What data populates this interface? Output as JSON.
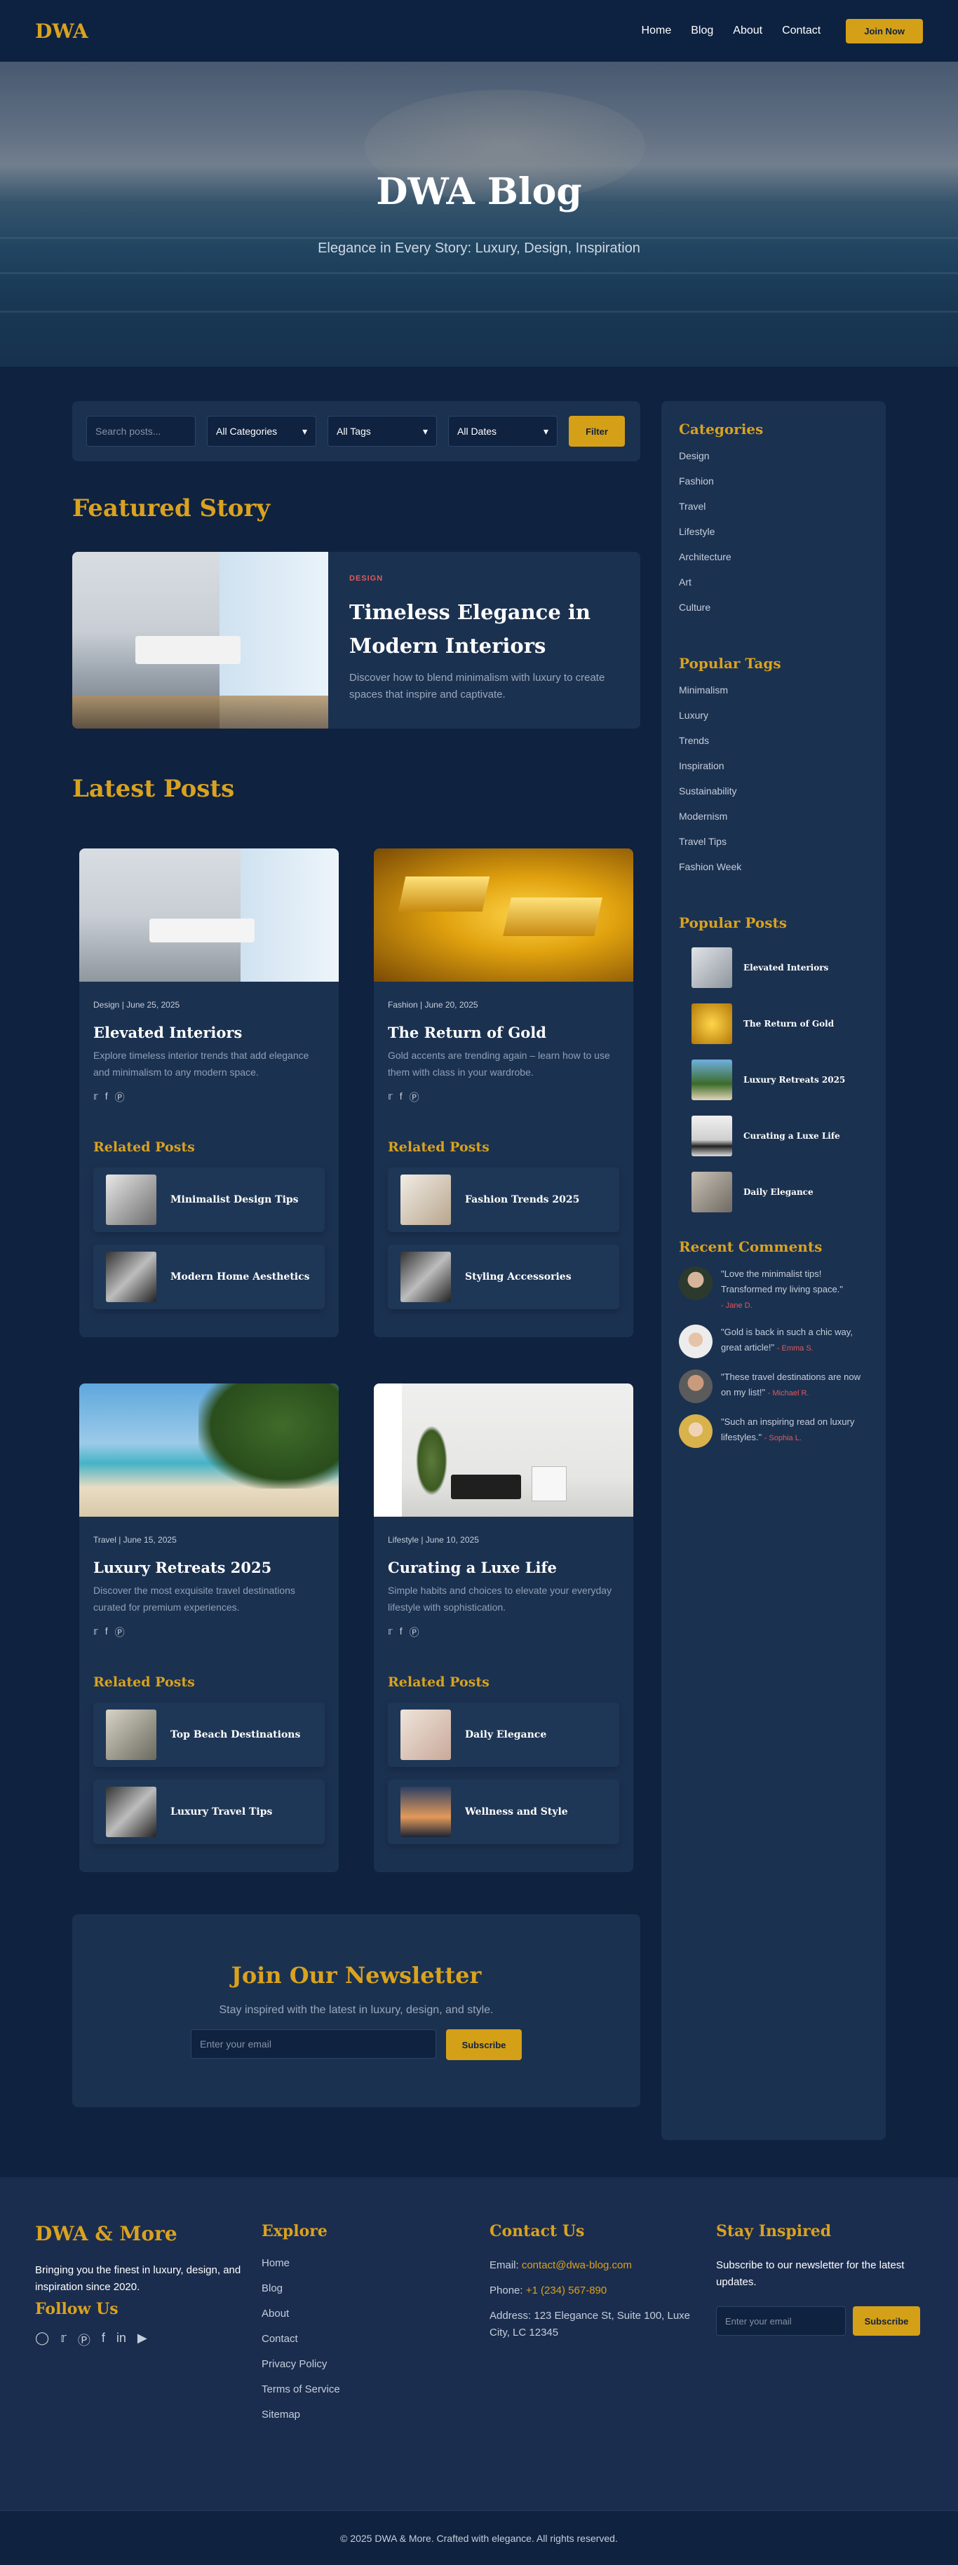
{
  "header": {
    "logo": "DWA",
    "nav": [
      "Home",
      "Blog",
      "About",
      "Contact"
    ],
    "cta": "Join Now"
  },
  "hero": {
    "title": "DWA Blog",
    "subtitle": "Elegance in Every Story: Luxury, Design, Inspiration"
  },
  "filters": {
    "search_placeholder": "Search posts...",
    "category": "All Categories",
    "tag": "All Tags",
    "date": "All Dates",
    "button": "Filter"
  },
  "featured": {
    "heading": "Featured Story",
    "tag": "DESIGN",
    "title": "Timeless Elegance in Modern Interiors",
    "excerpt": "Discover how to blend minimalism with luxury to create spaces that inspire and captivate."
  },
  "latest": {
    "heading": "Latest Posts",
    "related_heading": "Related Posts",
    "posts": [
      {
        "meta": "Design | June 25, 2025",
        "title": "Elevated Interiors",
        "excerpt": "Explore timeless interior trends that add elegance and minimalism to any modern space.",
        "related": [
          "Minimalist Design Tips",
          "Modern Home Aesthetics"
        ]
      },
      {
        "meta": "Fashion | June 20, 2025",
        "title": "The Return of Gold",
        "excerpt": "Gold accents are trending again – learn how to use them with class in your wardrobe.",
        "related": [
          "Fashion Trends 2025",
          "Styling Accessories"
        ]
      },
      {
        "meta": "Travel | June 15, 2025",
        "title": "Luxury Retreats 2025",
        "excerpt": "Discover the most exquisite travel destinations curated for premium experiences.",
        "related": [
          "Top Beach Destinations",
          "Luxury Travel Tips"
        ]
      },
      {
        "meta": "Lifestyle | June 10, 2025",
        "title": "Curating a Luxe Life",
        "excerpt": "Simple habits and choices to elevate your everyday lifestyle with sophistication.",
        "related": [
          "Daily Elegance",
          "Wellness and Style"
        ]
      }
    ]
  },
  "newsletter": {
    "title": "Join Our Newsletter",
    "text": "Stay inspired with the latest in luxury, design, and style.",
    "placeholder": "Enter your email",
    "button": "Subscribe"
  },
  "sidebar": {
    "categories_title": "Categories",
    "categories": [
      "Design",
      "Fashion",
      "Travel",
      "Lifestyle",
      "Architecture",
      "Art",
      "Culture"
    ],
    "tags_title": "Popular Tags",
    "tags": [
      "Minimalism",
      "Luxury",
      "Trends",
      "Inspiration",
      "Sustainability",
      "Modernism",
      "Travel Tips",
      "Fashion Week"
    ],
    "popular_title": "Popular Posts",
    "popular": [
      "Elevated Interiors",
      "The Return of Gold",
      "Luxury Retreats 2025",
      "Curating a Luxe Life",
      "Daily Elegance"
    ],
    "comments_title": "Recent Comments",
    "comments": [
      {
        "text": "\"Love the minimalist tips! Transformed my living space.\"",
        "author": "- Jane D."
      },
      {
        "text": "\"Gold is back in such a chic way, great article!\"",
        "author": "- Emma S."
      },
      {
        "text": "\"These travel destinations are now on my list!\"",
        "author": "- Michael R."
      },
      {
        "text": "\"Such an inspiring read on luxury lifestyles.\"",
        "author": "- Sophia L."
      }
    ]
  },
  "footer": {
    "brand": "DWA & More",
    "tagline": "Bringing you the finest in luxury, design, and inspiration since 2020.",
    "follow": "Follow Us",
    "explore_title": "Explore",
    "explore": [
      "Home",
      "Blog",
      "About",
      "Contact",
      "Privacy Policy",
      "Terms of Service",
      "Sitemap"
    ],
    "contact_title": "Contact Us",
    "email_label": "Email: ",
    "email": "contact@dwa-blog.com",
    "phone_label": "Phone: ",
    "phone": "+1 (234) 567-890",
    "address": "Address: 123 Elegance St, Suite 100, Luxe City, LC 12345",
    "stay_title": "Stay Inspired",
    "stay_text": "Subscribe to our newsletter for the latest updates.",
    "placeholder": "Enter your email",
    "button": "Subscribe",
    "copyright": "© 2025 DWA & More. Crafted with elegance. All rights reserved."
  },
  "colors": {
    "accent": "#d4a017",
    "background": "#0f2240",
    "panel": "#1b3150",
    "highlight": "#e05a5a"
  },
  "icons": [
    "twitter-icon",
    "facebook-icon",
    "pinterest-icon",
    "instagram-icon",
    "linkedin-icon",
    "youtube-icon"
  ]
}
